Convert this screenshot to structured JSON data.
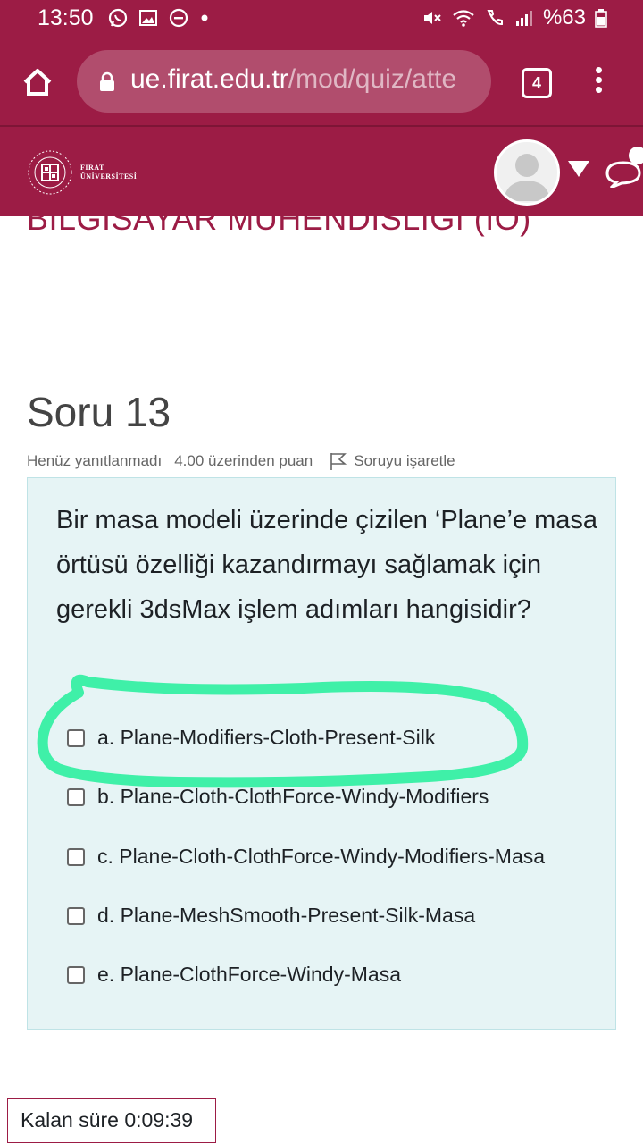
{
  "status_bar": {
    "time": "13:50",
    "battery": "%63",
    "icons": [
      "whatsapp-icon",
      "gallery-icon",
      "do-not-disturb-icon",
      "dot-icon",
      "mute-icon",
      "wifi-icon",
      "wifi-call-icon",
      "signal-icon",
      "battery-icon"
    ]
  },
  "browser": {
    "url_domain": "ue.firat.edu.tr",
    "url_path": "/mod/quiz/atte",
    "tab_count": "4"
  },
  "site_header": {
    "logo_line1": "FIRAT",
    "logo_line2": "ÜNİVERSİTESİ",
    "brand_color": "#9c1c45"
  },
  "course_title": "BİLGİSAYAR MÜHENDİSLİĞİ (İÖ)",
  "question": {
    "heading": "Soru 13",
    "status": "Henüz yanıtlanmadı",
    "points": "4.00 üzerinden puan",
    "flag_label": "Soruyu işaretle",
    "text": "Bir masa modeli üzerinde çizilen ‘Plane’e masa örtüsü özelliği kazandırmayı sağlamak için gerekli 3dsMax işlem adımları hangisidir?",
    "answers": [
      {
        "label": "a. Plane-Modifiers-Cloth-Present-Silk",
        "checked": false
      },
      {
        "label": "b. Plane-Cloth-ClothForce-Windy-Modifiers",
        "checked": false
      },
      {
        "label": "c. Plane-Cloth-ClothForce-Windy-Modifiers-Masa",
        "checked": false
      },
      {
        "label": "d. Plane-MeshSmooth-Present-Silk-Masa",
        "checked": false
      },
      {
        "label": "e. Plane-ClothForce-Windy-Masa",
        "checked": false
      }
    ]
  },
  "timer": {
    "label": "Kalan süre 0:09:39"
  }
}
